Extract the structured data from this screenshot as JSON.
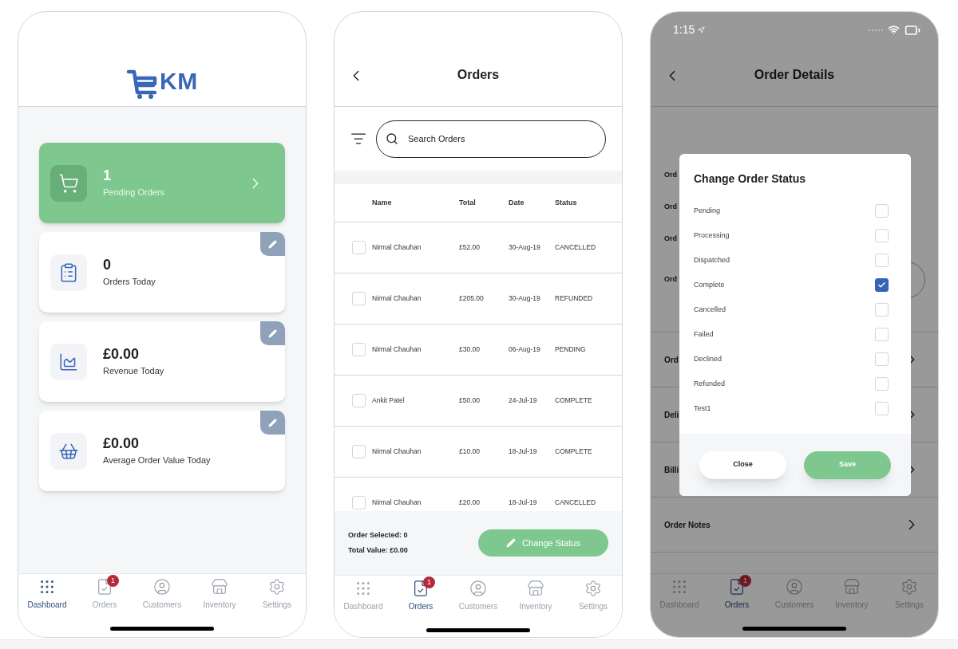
{
  "dashboard": {
    "logo_text": "KM",
    "cards": [
      {
        "kind": "highlight",
        "value": "1",
        "label": "Pending Orders"
      },
      {
        "kind": "stat",
        "value": "0",
        "label": "Orders Today"
      },
      {
        "kind": "stat",
        "value": "£0.00",
        "label": "Revenue Today"
      },
      {
        "kind": "stat",
        "value": "£0.00",
        "label": "Average Order Value Today"
      }
    ],
    "tab_bar": [
      {
        "label": "Dashboard",
        "selected": true
      },
      {
        "label": "Orders",
        "selected": false,
        "badge": "1"
      },
      {
        "label": "Customers",
        "selected": false
      },
      {
        "label": "Inventory",
        "selected": false
      },
      {
        "label": "Settings",
        "selected": false
      }
    ]
  },
  "orders": {
    "title": "Orders",
    "search": {
      "placeholder": "Search Orders"
    },
    "columns": [
      "Name",
      "Total",
      "Date",
      "Status"
    ],
    "rows": [
      {
        "name": "Nirmal Chauhan",
        "total": "£52.00",
        "date": "30-Aug-19",
        "status": "CANCELLED",
        "checked": false
      },
      {
        "name": "Nirmal Chauhan",
        "total": "£205.00",
        "date": "30-Aug-19",
        "status": "REFUNDED",
        "checked": false
      },
      {
        "name": "Nirmal Chauhan",
        "total": "£30.00",
        "date": "06-Aug-19",
        "status": "PENDING",
        "checked": false
      },
      {
        "name": "Ankit Patel",
        "total": "£50.00",
        "date": "24-Jul-19",
        "status": "COMPLETE",
        "checked": false
      },
      {
        "name": "Nirmal Chauhan",
        "total": "£10.00",
        "date": "18-Jul-19",
        "status": "COMPLETE",
        "checked": false
      },
      {
        "name": "Nirmal Chauhan",
        "total": "£20.00",
        "date": "18-Jul-19",
        "status": "CANCELLED",
        "checked": false
      }
    ],
    "summary": [
      "Order Selected: 0",
      "Total Value: £0.00"
    ],
    "action_button": "Change Status",
    "tab_bar": [
      {
        "label": "Dashboard",
        "selected": false
      },
      {
        "label": "Orders",
        "selected": true,
        "badge": "1"
      },
      {
        "label": "Customers",
        "selected": false
      },
      {
        "label": "Inventory",
        "selected": false
      },
      {
        "label": "Settings",
        "selected": false
      }
    ]
  },
  "order_details": {
    "status_bar": {
      "time": "1:15"
    },
    "title": "Order Details",
    "rows": [
      {
        "kind": "field",
        "label": "Ord"
      },
      {
        "kind": "field",
        "label": "Ord"
      },
      {
        "kind": "field",
        "label": "Ord"
      },
      {
        "kind": "dropdown",
        "label": "Ord"
      },
      {
        "kind": "link",
        "label": "Ord"
      },
      {
        "kind": "link",
        "label": "Deli"
      },
      {
        "kind": "link",
        "label": "Billi"
      },
      {
        "kind": "link",
        "label": "Order Notes"
      }
    ],
    "dialog": {
      "title": "Change Order Status",
      "options": [
        {
          "label": "Pending",
          "checked": false
        },
        {
          "label": "Processing",
          "checked": false
        },
        {
          "label": "Dispatched",
          "checked": false
        },
        {
          "label": "Complete",
          "checked": true
        },
        {
          "label": "Cancelled",
          "checked": false
        },
        {
          "label": "Failed",
          "checked": false
        },
        {
          "label": "Declined",
          "checked": false
        },
        {
          "label": "Refunded",
          "checked": false
        },
        {
          "label": "Test1",
          "checked": false
        }
      ],
      "buttons": [
        {
          "kind": "secondary",
          "label": "Close"
        },
        {
          "kind": "primary",
          "label": "Save"
        }
      ]
    },
    "tab_bar": [
      {
        "label": "Dashboard",
        "selected": false
      },
      {
        "label": "Orders",
        "selected": true,
        "badge": "1"
      },
      {
        "label": "Customers",
        "selected": false
      },
      {
        "label": "Inventory",
        "selected": false
      },
      {
        "label": "Settings",
        "selected": false
      }
    ]
  }
}
